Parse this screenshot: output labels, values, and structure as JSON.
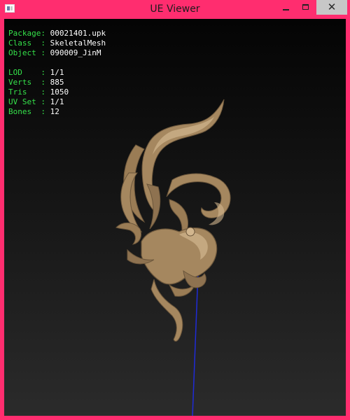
{
  "window": {
    "title": "UE Viewer",
    "controls": {
      "minimize": "minimize",
      "maximize": "maximize",
      "close": "✕"
    }
  },
  "info_panel": {
    "package": {
      "key": "Package: ",
      "value": "00021401.upk"
    },
    "class": {
      "key": "Class  : ",
      "value": "SkeletalMesh"
    },
    "object": {
      "key": "Object : ",
      "value": "090009_JinM"
    },
    "lod": {
      "key": "LOD    : ",
      "value": "1/1"
    },
    "verts": {
      "key": "Verts  : ",
      "value": "885"
    },
    "tris": {
      "key": "Tris   : ",
      "value": "1050"
    },
    "uv_set": {
      "key": "UV Set : ",
      "value": "1/1"
    },
    "bones": {
      "key": "Bones  : ",
      "value": "12"
    }
  },
  "colors": {
    "window_frame": "#ff2d6f",
    "info_key": "#35e24a",
    "info_value": "#ffffff",
    "mesh_base": "#a5875f",
    "mesh_shadow": "#6b563b",
    "mesh_highlight": "#d2b68e",
    "bone_line": "#1f2bd8"
  },
  "icons": {
    "app": "app-window-icon",
    "close": "close-icon",
    "minimize": "minimize-icon",
    "maximize": "maximize-icon"
  }
}
